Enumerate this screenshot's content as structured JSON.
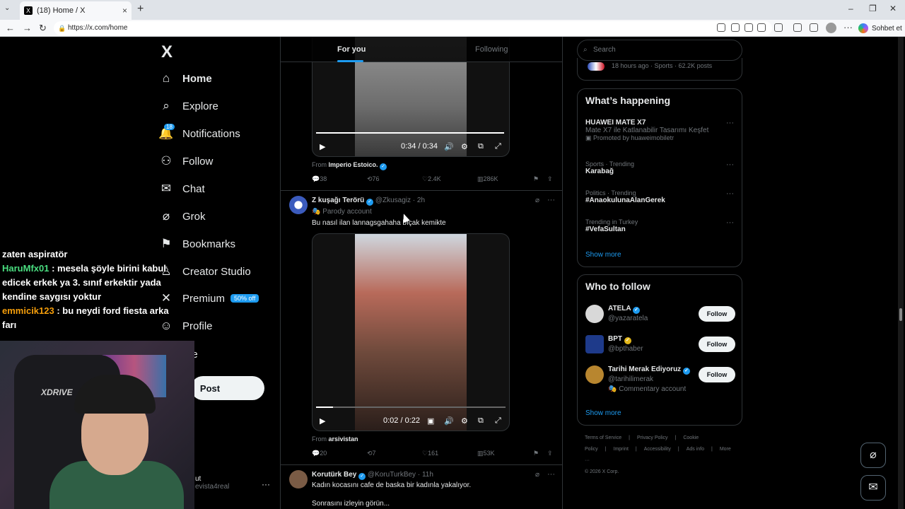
{
  "browser": {
    "tab_title": "(18) Home / X",
    "url": "https://x.com/home",
    "copilot_label": "Sohbet et"
  },
  "nav": {
    "logo": "X",
    "items": [
      {
        "label": "Home",
        "icon": "home-icon",
        "glyph": "⌂"
      },
      {
        "label": "Explore",
        "icon": "search-icon",
        "glyph": "⌕"
      },
      {
        "label": "Notifications",
        "icon": "bell-icon",
        "glyph": "🔔",
        "badge": "18"
      },
      {
        "label": "Follow",
        "icon": "add-user-icon",
        "glyph": "⚇"
      },
      {
        "label": "Chat",
        "icon": "envelope-icon",
        "glyph": "✉"
      },
      {
        "label": "Grok",
        "icon": "grok-icon",
        "glyph": "⌀"
      },
      {
        "label": "Bookmarks",
        "icon": "bookmark-icon",
        "glyph": "⚑"
      },
      {
        "label": "Creator Studio",
        "icon": "creator-studio-icon",
        "glyph": "♙"
      },
      {
        "label": "Premium",
        "icon": "x-premium-icon",
        "glyph": "✕",
        "promo": "50% off"
      },
      {
        "label": "Profile",
        "icon": "person-icon",
        "glyph": "☺"
      },
      {
        "label": "ore",
        "icon": "more-icon",
        "glyph": "⋯"
      }
    ],
    "post_label": "Post",
    "account_name": "ut",
    "account_handle": "evista4real"
  },
  "overlay_chat": {
    "line0": "zaten aspiratör",
    "user1": "HaruMfx01",
    "msg1": " : mesela şöyle birini kabul edicek erkek ya 3. sınıf erkektir yada kendine saygısı yoktur",
    "user2": "emmicik123",
    "msg2": " : bu neydi ford fiesta arka farı"
  },
  "webcam": {
    "chair_brand": "XDRIVE"
  },
  "feed": {
    "tab_for_you": "For you",
    "tab_following": "Following",
    "post1": {
      "video_time": "0:34 / 0:34",
      "from_label": "From",
      "from_user": "Imperio Estoico.",
      "replies": "38",
      "reposts": "76",
      "likes": "2.4K",
      "views": "286K",
      "progress": 1.0
    },
    "post2": {
      "name": "Z kuşağı Terörü",
      "handle": "@Zkusagiz",
      "time": "· 2h",
      "parody": "Parody account",
      "text": "Bu nasıl ilan lannagsgahaha bıçak kemikte",
      "video_time": "0:02 / 0:22",
      "from_label": "From",
      "from_user": "arsivistan",
      "replies": "20",
      "reposts": "7",
      "likes": "161",
      "views": "53K",
      "progress": 0.09
    },
    "post3": {
      "name": "Korutürk Bey",
      "handle": "@KoruTurkBey",
      "time": "· 11h",
      "text": "Kadın kocasını cafe de baska bir kadınla yakalıyor.",
      "text2": "Sonrasını izleyin görün..."
    }
  },
  "right": {
    "search_placeholder": "Search",
    "top_meta": "18 hours ago · Sports · 62.2K posts",
    "whats_happening": "What’s happening",
    "trends": [
      {
        "cat": "",
        "name": "HUAWEI MATE X7",
        "desc": "Mate X7 ile Katlanabilir Tasarımı Keşfet",
        "promo": "Promoted by huaweimobiletr"
      },
      {
        "cat": "Sports · Trending",
        "name": "Karabağ"
      },
      {
        "cat": "Politics · Trending",
        "name": "#AnaokulunaAlanGerek"
      },
      {
        "cat": "Trending in Turkey",
        "name": "#VefaSultan"
      }
    ],
    "show_more": "Show more",
    "who_to_follow": "Who to follow",
    "follow_label": "Follow",
    "suggestions": [
      {
        "name": "ATELA",
        "handle": "@yazaratela",
        "extra": ""
      },
      {
        "name": "BPT",
        "handle": "@bpthaber",
        "extra": ""
      },
      {
        "name": "Tarihi Merak Ediyoruz",
        "handle": "@tarihilimerak",
        "extra": "Commentary account"
      }
    ],
    "show_more2": "Show more",
    "footer": [
      "Terms of Service",
      "|",
      "Privacy Policy",
      "|",
      "Cookie Policy",
      "|",
      "Imprint",
      "|",
      "Accessibility",
      "|",
      "Ads info",
      "|",
      "More ···"
    ],
    "copyright": "© 2026 X Corp."
  }
}
